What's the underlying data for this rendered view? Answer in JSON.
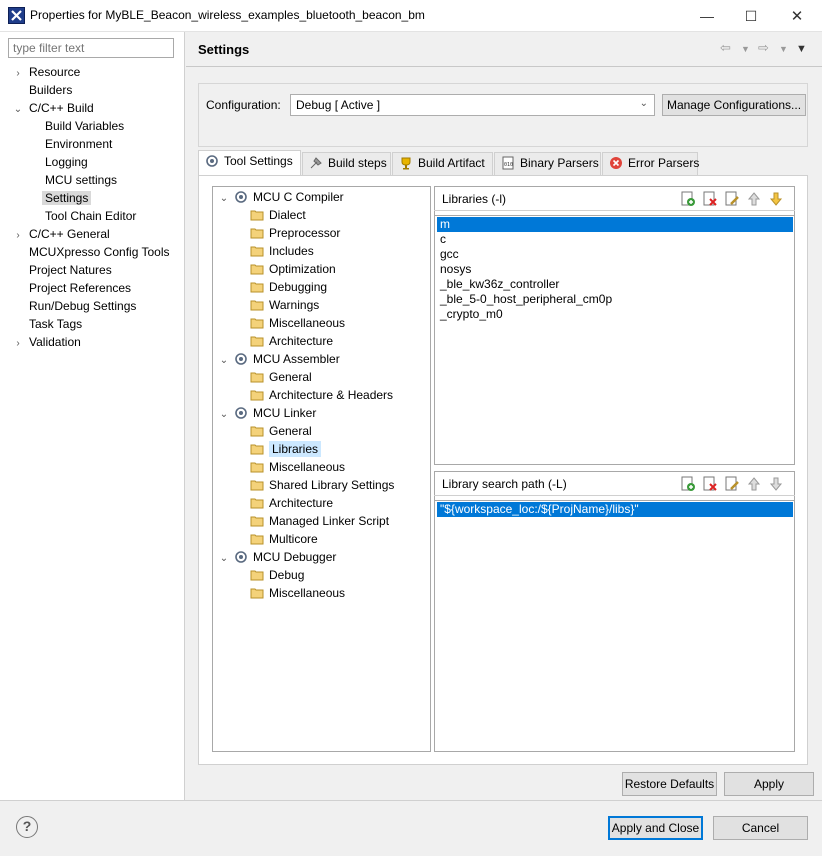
{
  "window": {
    "title": "Properties for MyBLE_Beacon_wireless_examples_bluetooth_beacon_bm",
    "minimize_glyph": "—",
    "maximize_glyph": "☐",
    "close_glyph": "✕"
  },
  "filter": {
    "placeholder": "type filter text"
  },
  "left_tree": [
    {
      "label": "Resource",
      "twisty": "›"
    },
    {
      "label": "Builders",
      "twisty": ""
    },
    {
      "label": "C/C++ Build",
      "twisty": "⌄"
    },
    {
      "label": "Build Variables",
      "twisty": ""
    },
    {
      "label": "Environment",
      "twisty": ""
    },
    {
      "label": "Logging",
      "twisty": ""
    },
    {
      "label": "MCU settings",
      "twisty": ""
    },
    {
      "label": "Settings",
      "twisty": ""
    },
    {
      "label": "Tool Chain Editor",
      "twisty": ""
    },
    {
      "label": "C/C++ General",
      "twisty": "›"
    },
    {
      "label": "MCUXpresso Config Tools",
      "twisty": ""
    },
    {
      "label": "Project Natures",
      "twisty": ""
    },
    {
      "label": "Project References",
      "twisty": ""
    },
    {
      "label": "Run/Debug Settings",
      "twisty": ""
    },
    {
      "label": "Task Tags",
      "twisty": ""
    },
    {
      "label": "Validation",
      "twisty": "›"
    }
  ],
  "header": {
    "title": "Settings"
  },
  "configuration": {
    "label": "Configuration:",
    "value": "Debug  [ Active ]",
    "manage_button": "Manage Configurations..."
  },
  "tabs": [
    {
      "label": "Tool Settings",
      "icon": "tool-settings-icon"
    },
    {
      "label": "Build steps",
      "icon": "build-steps-icon"
    },
    {
      "label": "Build Artifact",
      "icon": "trophy-icon"
    },
    {
      "label": "Binary Parsers",
      "icon": "binary-icon"
    },
    {
      "label": "Error Parsers",
      "icon": "error-icon"
    }
  ],
  "tool_tree": [
    {
      "label": "MCU C Compiler",
      "type": "group"
    },
    {
      "label": "Dialect",
      "type": "leaf"
    },
    {
      "label": "Preprocessor",
      "type": "leaf"
    },
    {
      "label": "Includes",
      "type": "leaf"
    },
    {
      "label": "Optimization",
      "type": "leaf"
    },
    {
      "label": "Debugging",
      "type": "leaf"
    },
    {
      "label": "Warnings",
      "type": "leaf"
    },
    {
      "label": "Miscellaneous",
      "type": "leaf"
    },
    {
      "label": "Architecture",
      "type": "leaf"
    },
    {
      "label": "MCU Assembler",
      "type": "group"
    },
    {
      "label": "General",
      "type": "leaf"
    },
    {
      "label": "Architecture & Headers",
      "type": "leaf"
    },
    {
      "label": "MCU Linker",
      "type": "group"
    },
    {
      "label": "General",
      "type": "leaf"
    },
    {
      "label": "Libraries",
      "type": "leaf",
      "selected": true
    },
    {
      "label": "Miscellaneous",
      "type": "leaf"
    },
    {
      "label": "Shared Library Settings",
      "type": "leaf"
    },
    {
      "label": "Architecture",
      "type": "leaf"
    },
    {
      "label": "Managed Linker Script",
      "type": "leaf"
    },
    {
      "label": "Multicore",
      "type": "leaf"
    },
    {
      "label": "MCU Debugger",
      "type": "group"
    },
    {
      "label": "Debug",
      "type": "leaf"
    },
    {
      "label": "Miscellaneous",
      "type": "leaf"
    }
  ],
  "libraries": {
    "title": "Libraries (-l)",
    "items": [
      "m",
      "c",
      "gcc",
      "nosys",
      "_ble_kw36z_controller",
      "_ble_5-0_host_peripheral_cm0p",
      "_crypto_m0"
    ]
  },
  "library_search": {
    "title": "Library search path (-L)",
    "items": [
      "\"${workspace_loc:/${ProjName}/libs}\""
    ]
  },
  "buttons": {
    "restore_defaults": "Restore Defaults",
    "apply": "Apply",
    "apply_and_close": "Apply and Close",
    "cancel": "Cancel",
    "help": "?"
  },
  "colors": {
    "selection": "#0078d7",
    "tree_selection": "#cce8ff"
  }
}
